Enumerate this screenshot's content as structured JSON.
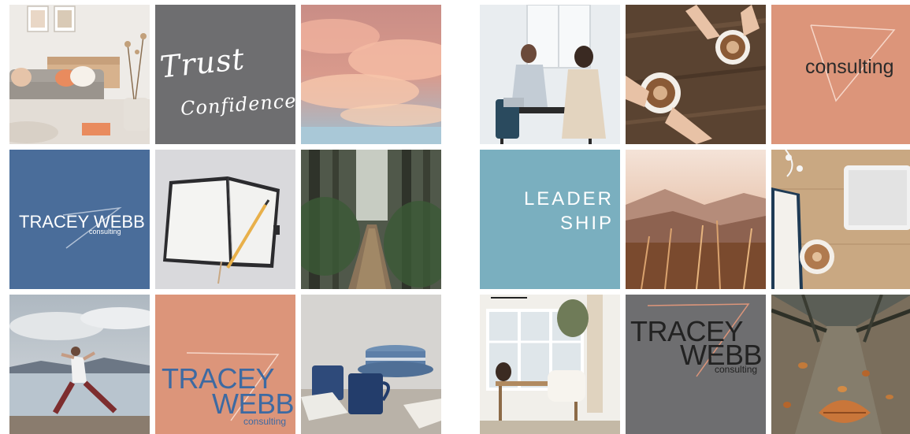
{
  "colors": {
    "gray": "#6e6e70",
    "blue": "#4a6d9a",
    "peach": "#dc957a",
    "teal": "#7aafbf",
    "accent_blue": "#3d6aa2"
  },
  "tiles": {
    "trust": {
      "line1": "Trust",
      "line2": "Confidence"
    },
    "brand_blue": {
      "name": "TRACEY WEBB",
      "sub": "consulting"
    },
    "brand_peach": {
      "line1": "TRACEY",
      "line2": "WEBB",
      "sub": "consulting"
    },
    "consulting": {
      "word": "consulting"
    },
    "leadership": {
      "line1": "LEADER",
      "line2": "SHIP"
    },
    "brand_gray": {
      "line1": "TRACEY",
      "line2": "WEBB",
      "sub": "consulting"
    }
  }
}
